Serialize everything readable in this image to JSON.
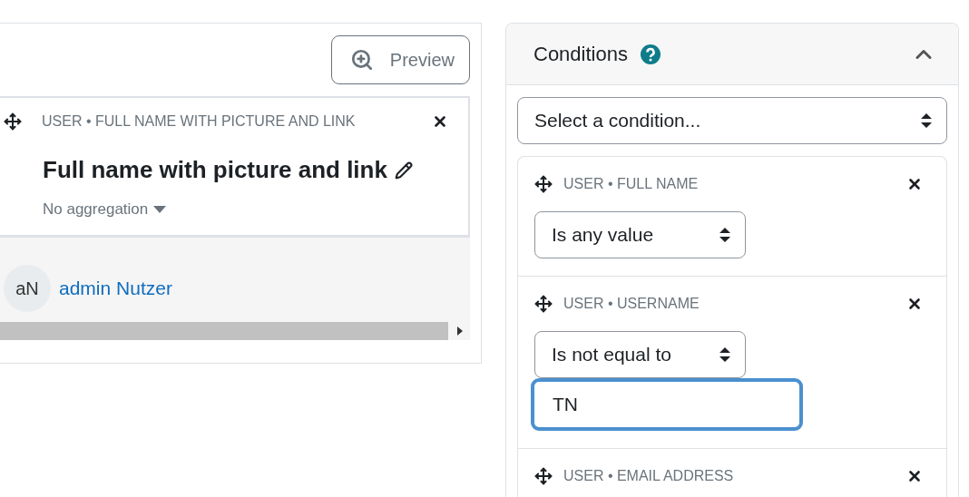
{
  "preview_button": {
    "label": "Preview"
  },
  "column": {
    "heading": "USER • FULL NAME WITH PICTURE AND LINK",
    "title": "Full name with picture and link",
    "aggregation": "No aggregation"
  },
  "rows": [
    {
      "avatar": "aN",
      "name": "admin Nutzer"
    }
  ],
  "conditions_panel": {
    "title": "Conditions",
    "expanded": true,
    "select_value": "Select a condition...",
    "conditions": [
      {
        "heading": "USER • FULL NAME",
        "operator": "Is any value"
      },
      {
        "heading": "USER • USERNAME",
        "operator": "Is not equal to",
        "value": "TN",
        "focused": true
      },
      {
        "heading": "USER • EMAIL ADDRESS"
      }
    ]
  }
}
